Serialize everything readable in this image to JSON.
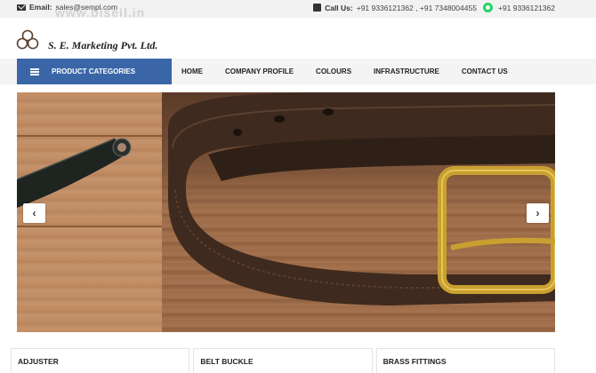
{
  "topbar": {
    "email_label": "Email:",
    "email_value": "sales@sempl.com",
    "call_label": "Call Us:",
    "call_numbers": "+91 9336121362 , +91 7348004455",
    "whatsapp_number": "+91 9336121362",
    "watermark": "www.biseil.in"
  },
  "brand": {
    "company_name": "S. E. Marketing Pvt. Ltd."
  },
  "nav": {
    "categories_label": "PRODUCT CATEGORIES",
    "links": [
      "HOME",
      "COMPANY PROFILE",
      "COLOURS",
      "INFRASTRUCTURE",
      "CONTACT US"
    ]
  },
  "slider": {
    "prev_glyph": "‹",
    "next_glyph": "›"
  },
  "categories": [
    "ADJUSTER",
    "BELT BUCKLE",
    "BRASS FITTINGS"
  ],
  "colors": {
    "nav_accent": "#3a66a8",
    "belt_leather": "#3e2a1e",
    "buckle_brass": "#c9a030",
    "whatsapp": "#25d366"
  }
}
